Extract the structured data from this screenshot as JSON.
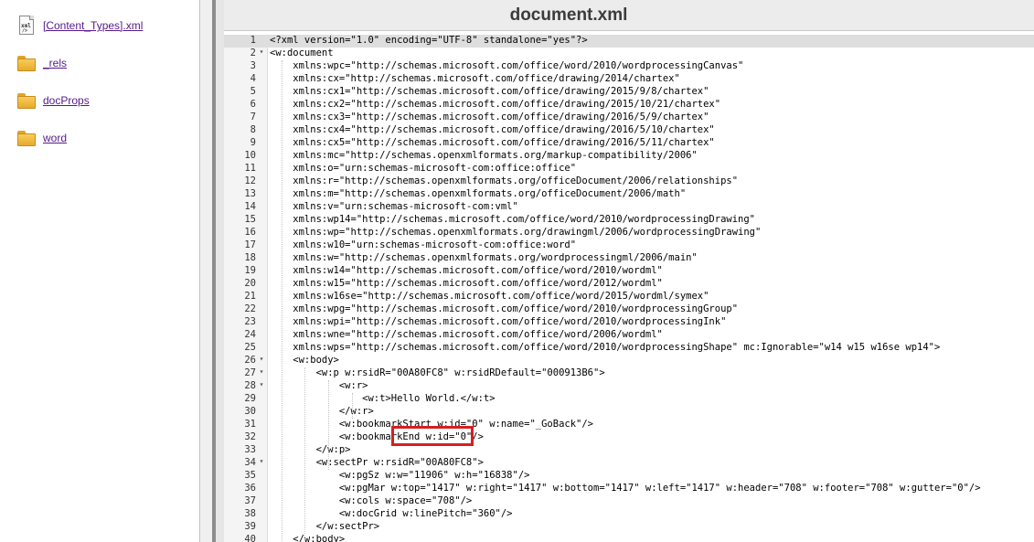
{
  "sidebar": {
    "items": [
      {
        "label": "[Content_Types].xml",
        "icon": "xml-file-icon"
      },
      {
        "label": "_rels",
        "icon": "folder-icon"
      },
      {
        "label": "docProps",
        "icon": "folder-icon"
      },
      {
        "label": "word",
        "icon": "folder-icon"
      }
    ]
  },
  "editor": {
    "title": "document.xml",
    "xml_icon_text": [
      "xml",
      "/>"
    ],
    "highlighted_text": "Hello World.",
    "lines": [
      {
        "n": "1",
        "fold": "",
        "text": "<?xml version=\"1.0\" encoding=\"UTF-8\" standalone=\"yes\"?>"
      },
      {
        "n": "2",
        "fold": "▾",
        "text": "<w:document"
      },
      {
        "n": "3",
        "fold": "",
        "text": "    xmlns:wpc=\"http://schemas.microsoft.com/office/word/2010/wordprocessingCanvas\""
      },
      {
        "n": "4",
        "fold": "",
        "text": "    xmlns:cx=\"http://schemas.microsoft.com/office/drawing/2014/chartex\""
      },
      {
        "n": "5",
        "fold": "",
        "text": "    xmlns:cx1=\"http://schemas.microsoft.com/office/drawing/2015/9/8/chartex\""
      },
      {
        "n": "6",
        "fold": "",
        "text": "    xmlns:cx2=\"http://schemas.microsoft.com/office/drawing/2015/10/21/chartex\""
      },
      {
        "n": "7",
        "fold": "",
        "text": "    xmlns:cx3=\"http://schemas.microsoft.com/office/drawing/2016/5/9/chartex\""
      },
      {
        "n": "8",
        "fold": "",
        "text": "    xmlns:cx4=\"http://schemas.microsoft.com/office/drawing/2016/5/10/chartex\""
      },
      {
        "n": "9",
        "fold": "",
        "text": "    xmlns:cx5=\"http://schemas.microsoft.com/office/drawing/2016/5/11/chartex\""
      },
      {
        "n": "10",
        "fold": "",
        "text": "    xmlns:mc=\"http://schemas.openxmlformats.org/markup-compatibility/2006\""
      },
      {
        "n": "11",
        "fold": "",
        "text": "    xmlns:o=\"urn:schemas-microsoft-com:office:office\""
      },
      {
        "n": "12",
        "fold": "",
        "text": "    xmlns:r=\"http://schemas.openxmlformats.org/officeDocument/2006/relationships\""
      },
      {
        "n": "13",
        "fold": "",
        "text": "    xmlns:m=\"http://schemas.openxmlformats.org/officeDocument/2006/math\""
      },
      {
        "n": "14",
        "fold": "",
        "text": "    xmlns:v=\"urn:schemas-microsoft-com:vml\""
      },
      {
        "n": "15",
        "fold": "",
        "text": "    xmlns:wp14=\"http://schemas.microsoft.com/office/word/2010/wordprocessingDrawing\""
      },
      {
        "n": "16",
        "fold": "",
        "text": "    xmlns:wp=\"http://schemas.openxmlformats.org/drawingml/2006/wordprocessingDrawing\""
      },
      {
        "n": "17",
        "fold": "",
        "text": "    xmlns:w10=\"urn:schemas-microsoft-com:office:word\""
      },
      {
        "n": "18",
        "fold": "",
        "text": "    xmlns:w=\"http://schemas.openxmlformats.org/wordprocessingml/2006/main\""
      },
      {
        "n": "19",
        "fold": "",
        "text": "    xmlns:w14=\"http://schemas.microsoft.com/office/word/2010/wordml\""
      },
      {
        "n": "20",
        "fold": "",
        "text": "    xmlns:w15=\"http://schemas.microsoft.com/office/word/2012/wordml\""
      },
      {
        "n": "21",
        "fold": "",
        "text": "    xmlns:w16se=\"http://schemas.microsoft.com/office/word/2015/wordml/symex\""
      },
      {
        "n": "22",
        "fold": "",
        "text": "    xmlns:wpg=\"http://schemas.microsoft.com/office/word/2010/wordprocessingGroup\""
      },
      {
        "n": "23",
        "fold": "",
        "text": "    xmlns:wpi=\"http://schemas.microsoft.com/office/word/2010/wordprocessingInk\""
      },
      {
        "n": "24",
        "fold": "",
        "text": "    xmlns:wne=\"http://schemas.microsoft.com/office/word/2006/wordml\""
      },
      {
        "n": "25",
        "fold": "",
        "text": "    xmlns:wps=\"http://schemas.microsoft.com/office/word/2010/wordprocessingShape\" mc:Ignorable=\"w14 w15 w16se wp14\">"
      },
      {
        "n": "26",
        "fold": "▾",
        "text": "    <w:body>"
      },
      {
        "n": "27",
        "fold": "▾",
        "text": "        <w:p w:rsidR=\"00A80FC8\" w:rsidRDefault=\"000913B6\">"
      },
      {
        "n": "28",
        "fold": "▾",
        "text": "            <w:r>"
      },
      {
        "n": "29",
        "fold": "",
        "text": "                <w:t>Hello World.</w:t>"
      },
      {
        "n": "30",
        "fold": "",
        "text": "            </w:r>"
      },
      {
        "n": "31",
        "fold": "",
        "text": "            <w:bookmarkStart w:id=\"0\" w:name=\"_GoBack\"/>"
      },
      {
        "n": "32",
        "fold": "",
        "text": "            <w:bookmarkEnd w:id=\"0\"/>"
      },
      {
        "n": "33",
        "fold": "",
        "text": "        </w:p>"
      },
      {
        "n": "34",
        "fold": "▾",
        "text": "        <w:sectPr w:rsidR=\"00A80FC8\">"
      },
      {
        "n": "35",
        "fold": "",
        "text": "            <w:pgSz w:w=\"11906\" w:h=\"16838\"/>"
      },
      {
        "n": "36",
        "fold": "",
        "text": "            <w:pgMar w:top=\"1417\" w:right=\"1417\" w:bottom=\"1417\" w:left=\"1417\" w:header=\"708\" w:footer=\"708\" w:gutter=\"0\"/>"
      },
      {
        "n": "37",
        "fold": "",
        "text": "            <w:cols w:space=\"708\"/>"
      },
      {
        "n": "38",
        "fold": "",
        "text": "            <w:docGrid w:linePitch=\"360\"/>"
      },
      {
        "n": "39",
        "fold": "",
        "text": "        </w:sectPr>"
      },
      {
        "n": "40",
        "fold": "",
        "text": "    </w:body>"
      }
    ]
  },
  "colors": {
    "highlight_box": "#d42020",
    "active_line": "#dedede",
    "link": "#551a8b"
  }
}
